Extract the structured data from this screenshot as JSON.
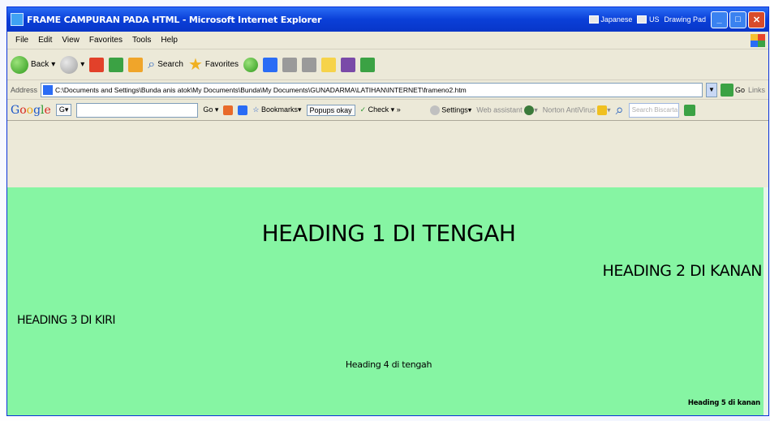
{
  "window": {
    "title": "FRAME CAMPURAN PADA HTML - Microsoft Internet Explorer",
    "tray": [
      "Japanese",
      "US",
      "Drawing Pad"
    ]
  },
  "menu": [
    "File",
    "Edit",
    "View",
    "Favorites",
    "Tools",
    "Help"
  ],
  "toolbar": {
    "back": "Back",
    "search": "Search",
    "favorites": "Favorites"
  },
  "address": {
    "label": "Address",
    "url": "C:\\Documents and Settings\\Bunda anis atok\\My Documents\\Bunda\\My Documents\\GUNADARMA\\LATIHAN\\INTERNET\\frameno2.htm",
    "go": "Go",
    "links": "Links"
  },
  "google": {
    "logo": [
      "G",
      "o",
      "o",
      "g",
      "l",
      "e"
    ],
    "g": "G",
    "go": "Go",
    "bookmarks": "Bookmarks",
    "popups": "Popups okay",
    "check": "Check",
    "more": "»",
    "settings": "Settings",
    "web_assistant": "Web assistant",
    "norton": "Norton AntiVirus",
    "search_placeholder": "Search Biscarta"
  },
  "content": {
    "bg_color": "#86f5a3",
    "heading1": "HEADING 1 DI TENGAH",
    "heading2": "HEADING 2 DI KANAN",
    "heading3": "HEADING 3 DI KIRI",
    "heading4": "Heading 4 di tengah",
    "heading5": "Heading 5 di kanan"
  }
}
